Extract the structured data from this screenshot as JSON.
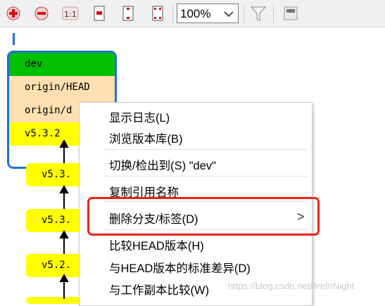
{
  "toolbar": {
    "buttons": [
      {
        "name": "zoom-in",
        "icon": "plus-circle-icon"
      },
      {
        "name": "zoom-out",
        "icon": "minus-circle-icon"
      },
      {
        "name": "zoom-actual",
        "label": "1:1",
        "icon": "actual-size-icon"
      },
      {
        "name": "fit-width",
        "icon": "fit-width-icon"
      },
      {
        "name": "fit-height",
        "icon": "fit-height-icon"
      },
      {
        "name": "fit-window",
        "icon": "fit-window-icon"
      }
    ],
    "zoom_value": "100%",
    "filter_icon": "funnel-icon",
    "panel_icon": "window-panel-icon"
  },
  "graph": {
    "head_refs": [
      "dev",
      "origin/HEAD",
      "origin/d",
      "v5.3.2"
    ],
    "head_colors": [
      "#00c000",
      "#ffe0b0",
      "#ffe0b0",
      "#ffff00"
    ],
    "tags": [
      "v5.3.",
      "v5.3.",
      "v5.2.",
      ""
    ],
    "tag_color": "#ffff00",
    "accent": "#1e6fd9"
  },
  "menu": {
    "items": [
      "显示日志(L)",
      "浏览版本库(B)",
      "切换/检出到(S) \"dev\"",
      "复制引用名称",
      "删除分支/标签(D)",
      "比较HEAD版本(H)",
      "与HEAD版本的标准差异(D)",
      "与工作副本比较(W)"
    ],
    "submenu_arrow": ">",
    "highlight_color": "#e8241a"
  },
  "watermark": "https://blog.csdn.net/fireInNight"
}
